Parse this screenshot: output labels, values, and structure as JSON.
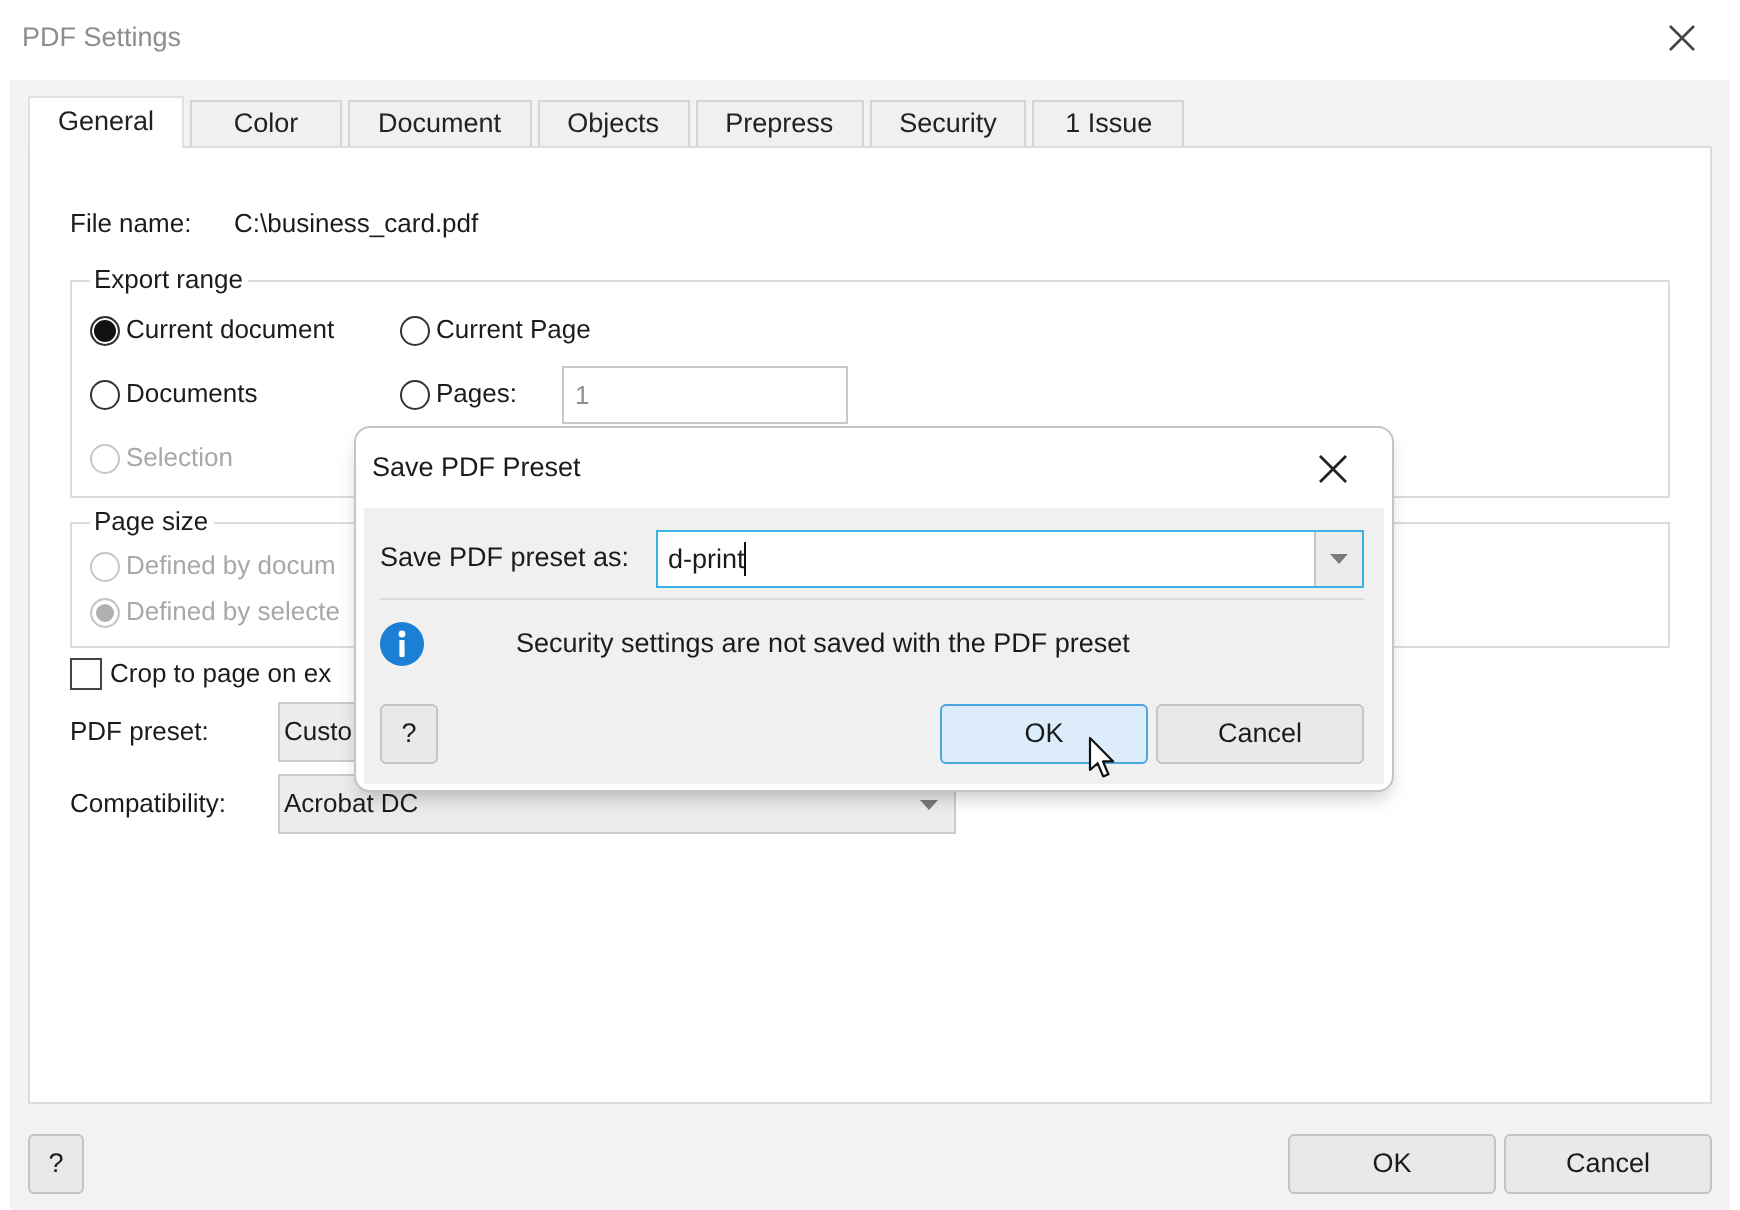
{
  "window": {
    "title": "PDF Settings"
  },
  "tabs": [
    {
      "label": "General",
      "selected": true
    },
    {
      "label": "Color",
      "selected": false
    },
    {
      "label": "Document",
      "selected": false
    },
    {
      "label": "Objects",
      "selected": false
    },
    {
      "label": "Prepress",
      "selected": false
    },
    {
      "label": "Security",
      "selected": false
    },
    {
      "label": "1 Issue",
      "selected": false
    }
  ],
  "general": {
    "file_name": {
      "label": "File name:",
      "value": "C:\\business_card.pdf"
    },
    "export_range": {
      "title": "Export range",
      "options": [
        {
          "label": "Current document",
          "selected": true,
          "disabled": false
        },
        {
          "label": "Current Page",
          "selected": false,
          "disabled": false
        },
        {
          "label": "Documents",
          "selected": false,
          "disabled": false
        },
        {
          "label": "Pages:",
          "selected": false,
          "disabled": false,
          "field": {
            "value": "1",
            "disabled": true
          }
        },
        {
          "label": "Selection",
          "selected": false,
          "disabled": true
        }
      ]
    },
    "page_size": {
      "title": "Page size",
      "options": [
        {
          "label": "Defined by docum",
          "selected": false,
          "disabled": true
        },
        {
          "label": "Defined by selecte",
          "selected": true,
          "disabled": true
        }
      ]
    },
    "crop_to_page": {
      "label": "Crop to page on ex",
      "checked": false
    },
    "pdf_preset": {
      "label": "PDF preset:",
      "value": "Custo"
    },
    "compatibility": {
      "label": "Compatibility:",
      "value": "Acrobat DC"
    }
  },
  "buttons": [
    {
      "label": "?",
      "kind": "help"
    },
    {
      "label": "OK",
      "kind": "ok"
    },
    {
      "label": "Cancel",
      "kind": "cancel"
    }
  ],
  "dialog": {
    "title": "Save PDF Preset",
    "field": {
      "label": "Save PDF preset as:",
      "value": "d-print",
      "focused": true
    },
    "message": "Security settings are not saved with the PDF preset",
    "buttons": [
      {
        "label": "?",
        "kind": "help",
        "highlighted": false
      },
      {
        "label": "OK",
        "kind": "ok",
        "highlighted": true
      },
      {
        "label": "Cancel",
        "kind": "cancel",
        "highlighted": false
      }
    ]
  }
}
